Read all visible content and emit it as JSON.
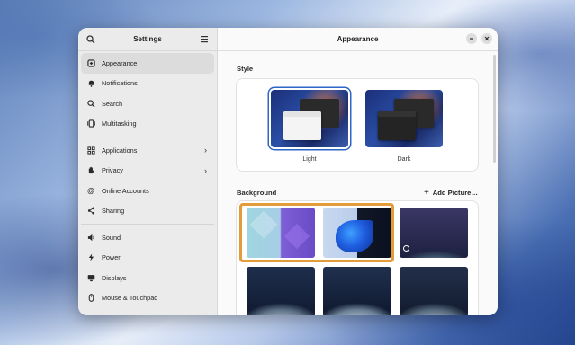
{
  "sidebar": {
    "title": "Settings",
    "items": [
      {
        "label": "Appearance",
        "icon": "appearance-icon",
        "active": true
      },
      {
        "label": "Notifications",
        "icon": "bell-icon"
      },
      {
        "label": "Search",
        "icon": "search-icon"
      },
      {
        "label": "Multitasking",
        "icon": "multitasking-icon"
      },
      {
        "label": "Applications",
        "icon": "grid-icon",
        "chevron": true
      },
      {
        "label": "Privacy",
        "icon": "hand-icon",
        "chevron": true
      },
      {
        "label": "Online Accounts",
        "icon": "at-icon"
      },
      {
        "label": "Sharing",
        "icon": "share-icon"
      },
      {
        "label": "Sound",
        "icon": "speaker-icon"
      },
      {
        "label": "Power",
        "icon": "power-icon"
      },
      {
        "label": "Displays",
        "icon": "display-icon"
      },
      {
        "label": "Mouse & Touchpad",
        "icon": "mouse-icon"
      }
    ]
  },
  "main": {
    "title": "Appearance",
    "style_label": "Style",
    "style_options": [
      {
        "label": "Light",
        "selected": true
      },
      {
        "label": "Dark",
        "selected": false
      }
    ],
    "background_label": "Background",
    "add_picture_label": "Add Picture…"
  },
  "colors": {
    "accent": "#2c66c8",
    "selection_ring": "#e39c3a"
  }
}
